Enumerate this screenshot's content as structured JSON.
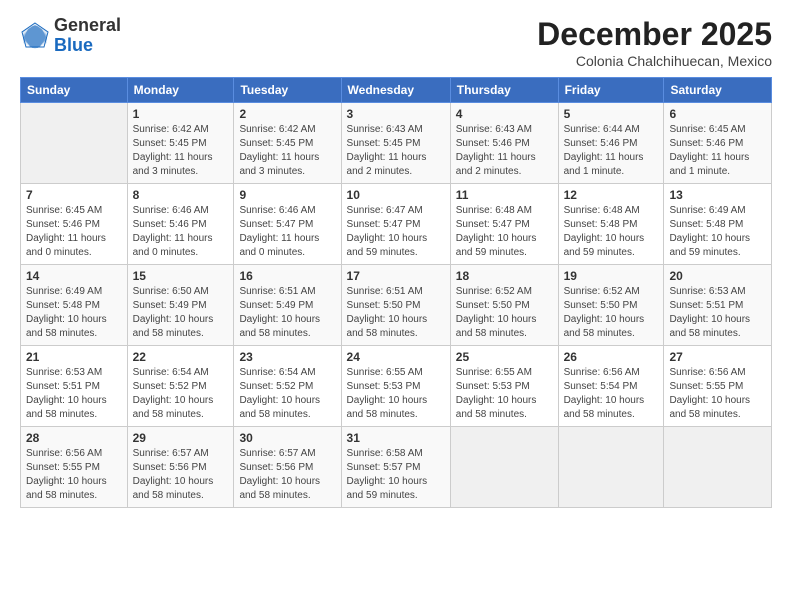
{
  "header": {
    "logo_general": "General",
    "logo_blue": "Blue",
    "month_title": "December 2025",
    "subtitle": "Colonia Chalchihuecan, Mexico"
  },
  "weekdays": [
    "Sunday",
    "Monday",
    "Tuesday",
    "Wednesday",
    "Thursday",
    "Friday",
    "Saturday"
  ],
  "weeks": [
    [
      {
        "day": "",
        "info": ""
      },
      {
        "day": "1",
        "info": "Sunrise: 6:42 AM\nSunset: 5:45 PM\nDaylight: 11 hours\nand 3 minutes."
      },
      {
        "day": "2",
        "info": "Sunrise: 6:42 AM\nSunset: 5:45 PM\nDaylight: 11 hours\nand 3 minutes."
      },
      {
        "day": "3",
        "info": "Sunrise: 6:43 AM\nSunset: 5:45 PM\nDaylight: 11 hours\nand 2 minutes."
      },
      {
        "day": "4",
        "info": "Sunrise: 6:43 AM\nSunset: 5:46 PM\nDaylight: 11 hours\nand 2 minutes."
      },
      {
        "day": "5",
        "info": "Sunrise: 6:44 AM\nSunset: 5:46 PM\nDaylight: 11 hours\nand 1 minute."
      },
      {
        "day": "6",
        "info": "Sunrise: 6:45 AM\nSunset: 5:46 PM\nDaylight: 11 hours\nand 1 minute."
      }
    ],
    [
      {
        "day": "7",
        "info": "Sunrise: 6:45 AM\nSunset: 5:46 PM\nDaylight: 11 hours\nand 0 minutes."
      },
      {
        "day": "8",
        "info": "Sunrise: 6:46 AM\nSunset: 5:46 PM\nDaylight: 11 hours\nand 0 minutes."
      },
      {
        "day": "9",
        "info": "Sunrise: 6:46 AM\nSunset: 5:47 PM\nDaylight: 11 hours\nand 0 minutes."
      },
      {
        "day": "10",
        "info": "Sunrise: 6:47 AM\nSunset: 5:47 PM\nDaylight: 10 hours\nand 59 minutes."
      },
      {
        "day": "11",
        "info": "Sunrise: 6:48 AM\nSunset: 5:47 PM\nDaylight: 10 hours\nand 59 minutes."
      },
      {
        "day": "12",
        "info": "Sunrise: 6:48 AM\nSunset: 5:48 PM\nDaylight: 10 hours\nand 59 minutes."
      },
      {
        "day": "13",
        "info": "Sunrise: 6:49 AM\nSunset: 5:48 PM\nDaylight: 10 hours\nand 59 minutes."
      }
    ],
    [
      {
        "day": "14",
        "info": "Sunrise: 6:49 AM\nSunset: 5:48 PM\nDaylight: 10 hours\nand 58 minutes."
      },
      {
        "day": "15",
        "info": "Sunrise: 6:50 AM\nSunset: 5:49 PM\nDaylight: 10 hours\nand 58 minutes."
      },
      {
        "day": "16",
        "info": "Sunrise: 6:51 AM\nSunset: 5:49 PM\nDaylight: 10 hours\nand 58 minutes."
      },
      {
        "day": "17",
        "info": "Sunrise: 6:51 AM\nSunset: 5:50 PM\nDaylight: 10 hours\nand 58 minutes."
      },
      {
        "day": "18",
        "info": "Sunrise: 6:52 AM\nSunset: 5:50 PM\nDaylight: 10 hours\nand 58 minutes."
      },
      {
        "day": "19",
        "info": "Sunrise: 6:52 AM\nSunset: 5:50 PM\nDaylight: 10 hours\nand 58 minutes."
      },
      {
        "day": "20",
        "info": "Sunrise: 6:53 AM\nSunset: 5:51 PM\nDaylight: 10 hours\nand 58 minutes."
      }
    ],
    [
      {
        "day": "21",
        "info": "Sunrise: 6:53 AM\nSunset: 5:51 PM\nDaylight: 10 hours\nand 58 minutes."
      },
      {
        "day": "22",
        "info": "Sunrise: 6:54 AM\nSunset: 5:52 PM\nDaylight: 10 hours\nand 58 minutes."
      },
      {
        "day": "23",
        "info": "Sunrise: 6:54 AM\nSunset: 5:52 PM\nDaylight: 10 hours\nand 58 minutes."
      },
      {
        "day": "24",
        "info": "Sunrise: 6:55 AM\nSunset: 5:53 PM\nDaylight: 10 hours\nand 58 minutes."
      },
      {
        "day": "25",
        "info": "Sunrise: 6:55 AM\nSunset: 5:53 PM\nDaylight: 10 hours\nand 58 minutes."
      },
      {
        "day": "26",
        "info": "Sunrise: 6:56 AM\nSunset: 5:54 PM\nDaylight: 10 hours\nand 58 minutes."
      },
      {
        "day": "27",
        "info": "Sunrise: 6:56 AM\nSunset: 5:55 PM\nDaylight: 10 hours\nand 58 minutes."
      }
    ],
    [
      {
        "day": "28",
        "info": "Sunrise: 6:56 AM\nSunset: 5:55 PM\nDaylight: 10 hours\nand 58 minutes."
      },
      {
        "day": "29",
        "info": "Sunrise: 6:57 AM\nSunset: 5:56 PM\nDaylight: 10 hours\nand 58 minutes."
      },
      {
        "day": "30",
        "info": "Sunrise: 6:57 AM\nSunset: 5:56 PM\nDaylight: 10 hours\nand 58 minutes."
      },
      {
        "day": "31",
        "info": "Sunrise: 6:58 AM\nSunset: 5:57 PM\nDaylight: 10 hours\nand 59 minutes."
      },
      {
        "day": "",
        "info": ""
      },
      {
        "day": "",
        "info": ""
      },
      {
        "day": "",
        "info": ""
      }
    ]
  ]
}
